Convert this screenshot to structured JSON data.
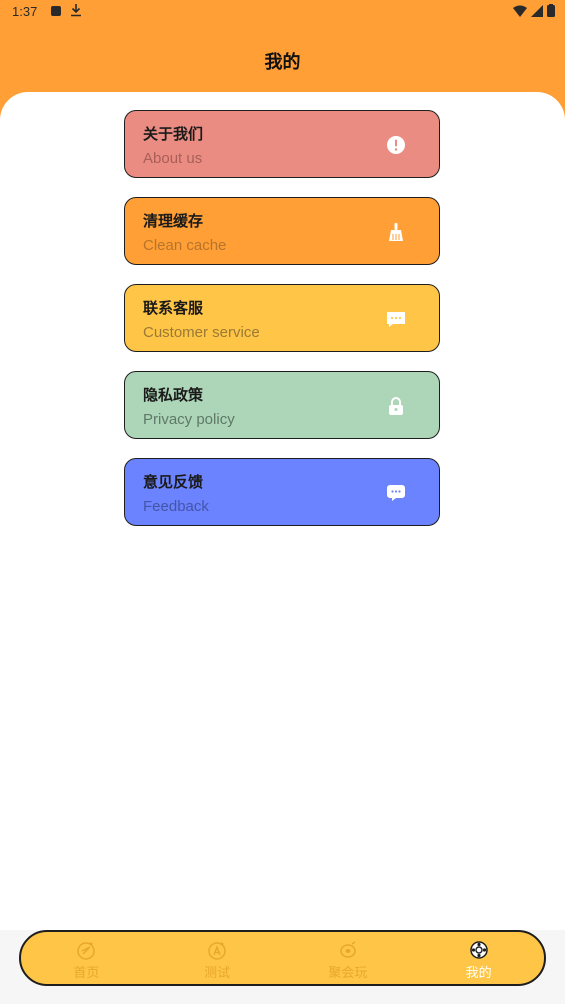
{
  "status_bar": {
    "time": "1:37"
  },
  "header": {
    "title": "我的"
  },
  "menu": [
    {
      "title": "关于我们",
      "subtitle": "About us",
      "icon": "info-icon",
      "bg": "#ea8c82",
      "sub_color": "#a85f58"
    },
    {
      "title": "清理缓存",
      "subtitle": "Clean cache",
      "icon": "broom-icon",
      "bg": "#ff9f35",
      "sub_color": "#b8742c"
    },
    {
      "title": "联系客服",
      "subtitle": "Customer service",
      "icon": "chat-bubble-icon",
      "bg": "#ffc547",
      "sub_color": "#9a7a36"
    },
    {
      "title": "隐私政策",
      "subtitle": "Privacy policy",
      "icon": "lock-icon",
      "bg": "#acd6b7",
      "sub_color": "#5f7867"
    },
    {
      "title": "意见反馈",
      "subtitle": "Feedback",
      "icon": "feedback-icon",
      "bg": "#6c83ff",
      "sub_color": "#4455a8"
    }
  ],
  "bottom_nav": [
    {
      "label": "首页",
      "icon": "home-icon",
      "active": false
    },
    {
      "label": "测试",
      "icon": "test-icon",
      "active": false
    },
    {
      "label": "聚会玩",
      "icon": "party-icon",
      "active": false
    },
    {
      "label": "我的",
      "icon": "profile-icon",
      "active": true
    }
  ]
}
